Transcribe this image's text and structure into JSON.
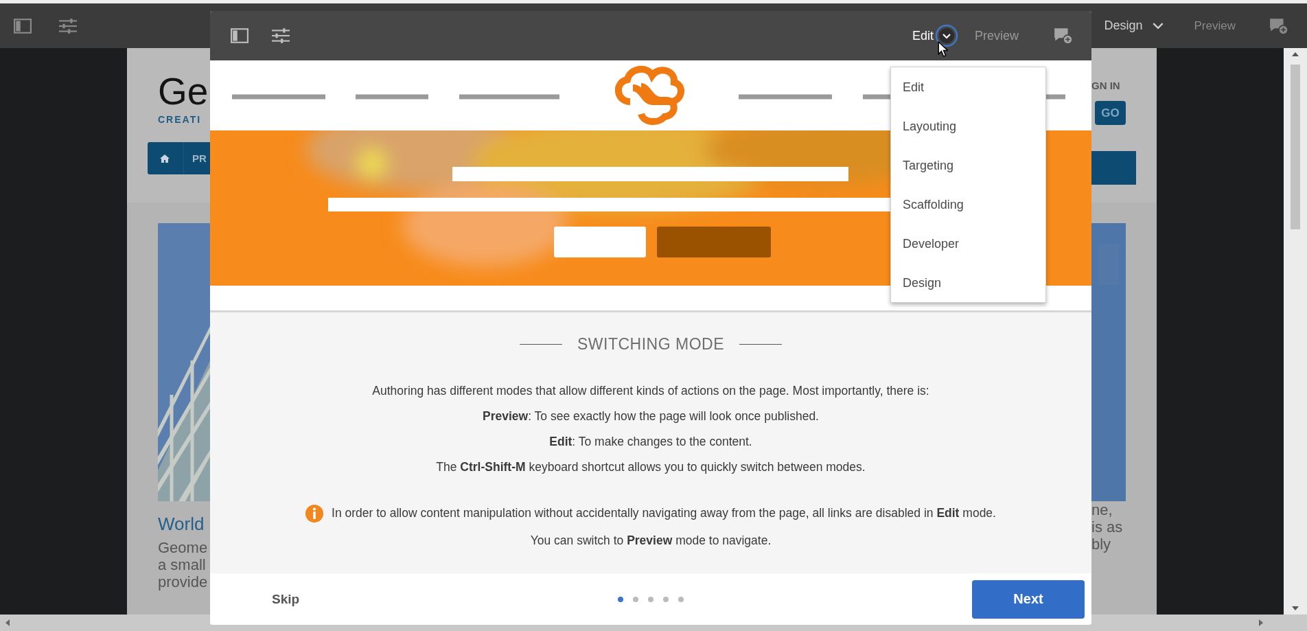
{
  "top_bar": {
    "mode_label": "Design",
    "preview_label": "Preview"
  },
  "background_page": {
    "logo_text": "Ge",
    "tagline": "CREATI",
    "nav_item": "PR",
    "article_title": "World",
    "article_lines": [
      "Geome",
      "a small",
      "provide"
    ],
    "sign_in": "GN IN",
    "go_button": "GO",
    "right_lines": [
      "ne,",
      "is as",
      "bly"
    ]
  },
  "dialog": {
    "toolbar": {
      "mode_label": "Edit",
      "preview_label": "Preview"
    },
    "mode_menu": [
      {
        "label": "Edit"
      },
      {
        "label": "Layouting"
      },
      {
        "label": "Targeting"
      },
      {
        "label": "Scaffolding"
      },
      {
        "label": "Developer"
      },
      {
        "label": "Design"
      }
    ],
    "title": "SWITCHING MODE",
    "paragraphs": [
      "Authoring has different modes that allow different kinds of actions on the page. Most importantly, there is:",
      "**Preview**: To see exactly how the page will look once published.",
      "**Edit**: To make changes to the content.",
      "The **Ctrl-Shift-M** keyboard shortcut allows you to quickly switch between modes."
    ],
    "notes": [
      {
        "kind": "info",
        "text": "In order to allow content manipulation without accidentally navigating away from the page, all links are disabled in **Edit** mode."
      },
      {
        "kind": "plain",
        "text": "You can switch to **Preview** mode to navigate."
      }
    ],
    "footer": {
      "skip": "Skip",
      "pages": [
        {
          "selected": true
        },
        {
          "selected": false
        },
        {
          "selected": false
        },
        {
          "selected": false
        },
        {
          "selected": false
        }
      ],
      "next": "Next"
    }
  }
}
